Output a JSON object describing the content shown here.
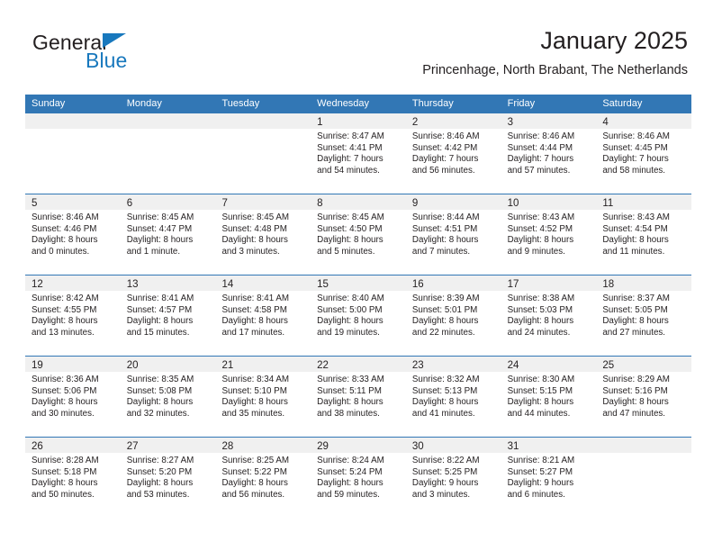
{
  "brand": {
    "name_part1": "General",
    "name_part2": "Blue",
    "accent_color": "#1878bd"
  },
  "header": {
    "title": "January 2025",
    "subtitle": "Princenhage, North Brabant, The Netherlands"
  },
  "theme": {
    "header_blue": "#3277b5",
    "daynum_band": "#f0f0f0",
    "text": "#231f20"
  },
  "weekday_headers": [
    "Sunday",
    "Monday",
    "Tuesday",
    "Wednesday",
    "Thursday",
    "Friday",
    "Saturday"
  ],
  "weeks": [
    [
      {
        "day": "",
        "sunrise": "",
        "sunset": "",
        "daylight1": "",
        "daylight2": ""
      },
      {
        "day": "",
        "sunrise": "",
        "sunset": "",
        "daylight1": "",
        "daylight2": ""
      },
      {
        "day": "",
        "sunrise": "",
        "sunset": "",
        "daylight1": "",
        "daylight2": ""
      },
      {
        "day": "1",
        "sunrise": "Sunrise: 8:47 AM",
        "sunset": "Sunset: 4:41 PM",
        "daylight1": "Daylight: 7 hours",
        "daylight2": "and 54 minutes."
      },
      {
        "day": "2",
        "sunrise": "Sunrise: 8:46 AM",
        "sunset": "Sunset: 4:42 PM",
        "daylight1": "Daylight: 7 hours",
        "daylight2": "and 56 minutes."
      },
      {
        "day": "3",
        "sunrise": "Sunrise: 8:46 AM",
        "sunset": "Sunset: 4:44 PM",
        "daylight1": "Daylight: 7 hours",
        "daylight2": "and 57 minutes."
      },
      {
        "day": "4",
        "sunrise": "Sunrise: 8:46 AM",
        "sunset": "Sunset: 4:45 PM",
        "daylight1": "Daylight: 7 hours",
        "daylight2": "and 58 minutes."
      }
    ],
    [
      {
        "day": "5",
        "sunrise": "Sunrise: 8:46 AM",
        "sunset": "Sunset: 4:46 PM",
        "daylight1": "Daylight: 8 hours",
        "daylight2": "and 0 minutes."
      },
      {
        "day": "6",
        "sunrise": "Sunrise: 8:45 AM",
        "sunset": "Sunset: 4:47 PM",
        "daylight1": "Daylight: 8 hours",
        "daylight2": "and 1 minute."
      },
      {
        "day": "7",
        "sunrise": "Sunrise: 8:45 AM",
        "sunset": "Sunset: 4:48 PM",
        "daylight1": "Daylight: 8 hours",
        "daylight2": "and 3 minutes."
      },
      {
        "day": "8",
        "sunrise": "Sunrise: 8:45 AM",
        "sunset": "Sunset: 4:50 PM",
        "daylight1": "Daylight: 8 hours",
        "daylight2": "and 5 minutes."
      },
      {
        "day": "9",
        "sunrise": "Sunrise: 8:44 AM",
        "sunset": "Sunset: 4:51 PM",
        "daylight1": "Daylight: 8 hours",
        "daylight2": "and 7 minutes."
      },
      {
        "day": "10",
        "sunrise": "Sunrise: 8:43 AM",
        "sunset": "Sunset: 4:52 PM",
        "daylight1": "Daylight: 8 hours",
        "daylight2": "and 9 minutes."
      },
      {
        "day": "11",
        "sunrise": "Sunrise: 8:43 AM",
        "sunset": "Sunset: 4:54 PM",
        "daylight1": "Daylight: 8 hours",
        "daylight2": "and 11 minutes."
      }
    ],
    [
      {
        "day": "12",
        "sunrise": "Sunrise: 8:42 AM",
        "sunset": "Sunset: 4:55 PM",
        "daylight1": "Daylight: 8 hours",
        "daylight2": "and 13 minutes."
      },
      {
        "day": "13",
        "sunrise": "Sunrise: 8:41 AM",
        "sunset": "Sunset: 4:57 PM",
        "daylight1": "Daylight: 8 hours",
        "daylight2": "and 15 minutes."
      },
      {
        "day": "14",
        "sunrise": "Sunrise: 8:41 AM",
        "sunset": "Sunset: 4:58 PM",
        "daylight1": "Daylight: 8 hours",
        "daylight2": "and 17 minutes."
      },
      {
        "day": "15",
        "sunrise": "Sunrise: 8:40 AM",
        "sunset": "Sunset: 5:00 PM",
        "daylight1": "Daylight: 8 hours",
        "daylight2": "and 19 minutes."
      },
      {
        "day": "16",
        "sunrise": "Sunrise: 8:39 AM",
        "sunset": "Sunset: 5:01 PM",
        "daylight1": "Daylight: 8 hours",
        "daylight2": "and 22 minutes."
      },
      {
        "day": "17",
        "sunrise": "Sunrise: 8:38 AM",
        "sunset": "Sunset: 5:03 PM",
        "daylight1": "Daylight: 8 hours",
        "daylight2": "and 24 minutes."
      },
      {
        "day": "18",
        "sunrise": "Sunrise: 8:37 AM",
        "sunset": "Sunset: 5:05 PM",
        "daylight1": "Daylight: 8 hours",
        "daylight2": "and 27 minutes."
      }
    ],
    [
      {
        "day": "19",
        "sunrise": "Sunrise: 8:36 AM",
        "sunset": "Sunset: 5:06 PM",
        "daylight1": "Daylight: 8 hours",
        "daylight2": "and 30 minutes."
      },
      {
        "day": "20",
        "sunrise": "Sunrise: 8:35 AM",
        "sunset": "Sunset: 5:08 PM",
        "daylight1": "Daylight: 8 hours",
        "daylight2": "and 32 minutes."
      },
      {
        "day": "21",
        "sunrise": "Sunrise: 8:34 AM",
        "sunset": "Sunset: 5:10 PM",
        "daylight1": "Daylight: 8 hours",
        "daylight2": "and 35 minutes."
      },
      {
        "day": "22",
        "sunrise": "Sunrise: 8:33 AM",
        "sunset": "Sunset: 5:11 PM",
        "daylight1": "Daylight: 8 hours",
        "daylight2": "and 38 minutes."
      },
      {
        "day": "23",
        "sunrise": "Sunrise: 8:32 AM",
        "sunset": "Sunset: 5:13 PM",
        "daylight1": "Daylight: 8 hours",
        "daylight2": "and 41 minutes."
      },
      {
        "day": "24",
        "sunrise": "Sunrise: 8:30 AM",
        "sunset": "Sunset: 5:15 PM",
        "daylight1": "Daylight: 8 hours",
        "daylight2": "and 44 minutes."
      },
      {
        "day": "25",
        "sunrise": "Sunrise: 8:29 AM",
        "sunset": "Sunset: 5:16 PM",
        "daylight1": "Daylight: 8 hours",
        "daylight2": "and 47 minutes."
      }
    ],
    [
      {
        "day": "26",
        "sunrise": "Sunrise: 8:28 AM",
        "sunset": "Sunset: 5:18 PM",
        "daylight1": "Daylight: 8 hours",
        "daylight2": "and 50 minutes."
      },
      {
        "day": "27",
        "sunrise": "Sunrise: 8:27 AM",
        "sunset": "Sunset: 5:20 PM",
        "daylight1": "Daylight: 8 hours",
        "daylight2": "and 53 minutes."
      },
      {
        "day": "28",
        "sunrise": "Sunrise: 8:25 AM",
        "sunset": "Sunset: 5:22 PM",
        "daylight1": "Daylight: 8 hours",
        "daylight2": "and 56 minutes."
      },
      {
        "day": "29",
        "sunrise": "Sunrise: 8:24 AM",
        "sunset": "Sunset: 5:24 PM",
        "daylight1": "Daylight: 8 hours",
        "daylight2": "and 59 minutes."
      },
      {
        "day": "30",
        "sunrise": "Sunrise: 8:22 AM",
        "sunset": "Sunset: 5:25 PM",
        "daylight1": "Daylight: 9 hours",
        "daylight2": "and 3 minutes."
      },
      {
        "day": "31",
        "sunrise": "Sunrise: 8:21 AM",
        "sunset": "Sunset: 5:27 PM",
        "daylight1": "Daylight: 9 hours",
        "daylight2": "and 6 minutes."
      },
      {
        "day": "",
        "sunrise": "",
        "sunset": "",
        "daylight1": "",
        "daylight2": ""
      }
    ]
  ]
}
